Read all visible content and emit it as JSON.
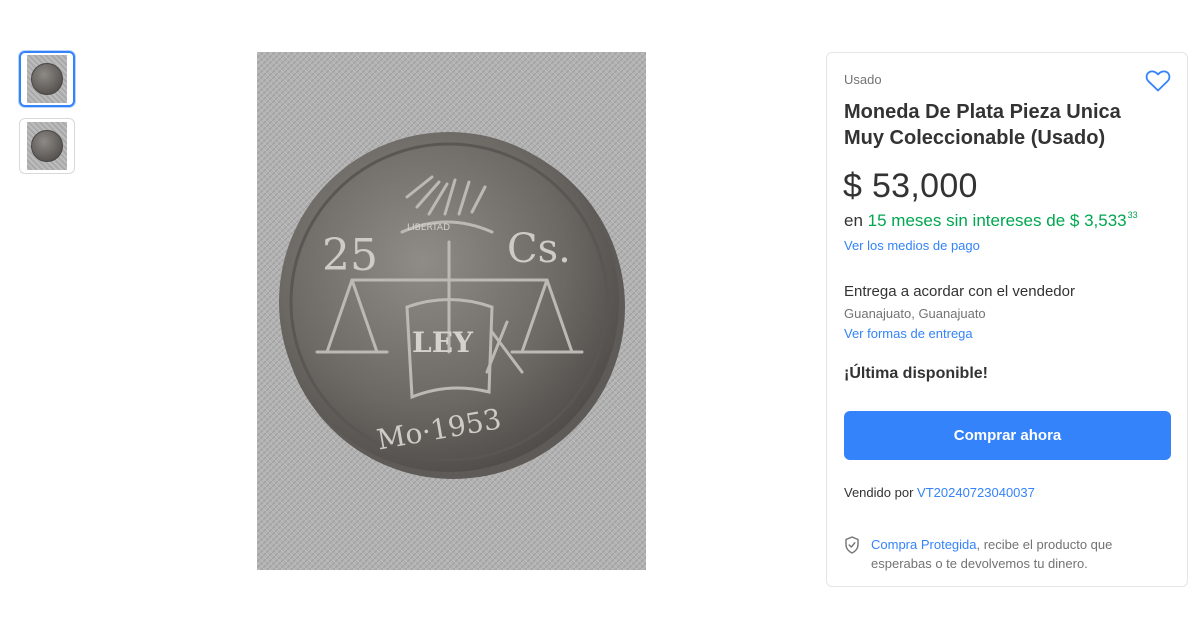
{
  "gallery": {
    "thumbnails": [
      {
        "name": "thumbnail-1",
        "active": true
      },
      {
        "name": "thumbnail-2",
        "active": false
      }
    ],
    "main_image": {
      "denomination": "25",
      "currency": "Cs.",
      "ribbon": "LIBERTAD",
      "shield": "LEY",
      "mint_year": "Mo·1953"
    }
  },
  "product": {
    "condition": "Usado",
    "favorite_icon": "heart-outline-icon",
    "title": "Moneda De Plata Pieza Unica Muy Coleccionable (Usado)",
    "price": "$ 53,000",
    "installments": {
      "prefix": "en",
      "months": "15 meses sin intereses de",
      "amount": "$ 3,533",
      "cents": "33"
    },
    "payment_link": "Ver los medios de pago",
    "delivery_title": "Entrega a acordar con el vendedor",
    "location": "Guanajuato, Guanajuato",
    "delivery_link": "Ver formas de entrega",
    "stock_text": "¡Última disponible!",
    "buy_button": "Comprar ahora",
    "seller_prefix": "Vendido por",
    "seller_name": "VT20240723040037",
    "protection_link": "Compra Protegida",
    "protection_text": ", recibe el producto que esperabas o te devolvemos tu dinero."
  },
  "colors": {
    "accent": "#3483fa",
    "installments_green": "#00a650",
    "text": "#333333",
    "muted": "#737373"
  }
}
